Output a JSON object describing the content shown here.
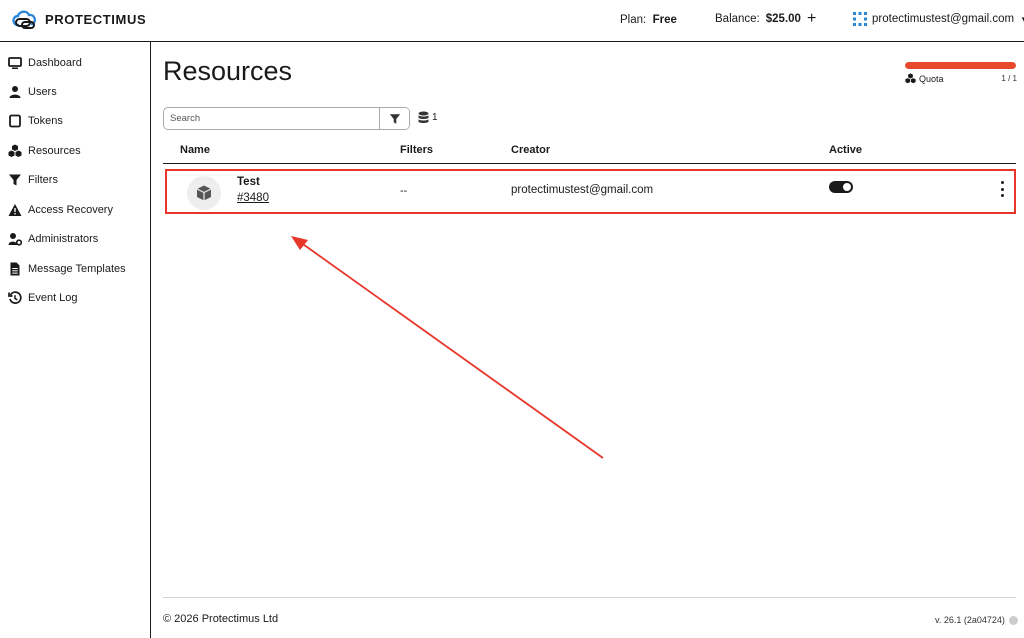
{
  "header": {
    "logo_text": "PROTECTIMUS",
    "plan_label": "Plan:",
    "plan_value": "Free",
    "balance_label": "Balance:",
    "balance_value": "$25.00",
    "account_email": "protectimustest@gmail.com"
  },
  "sidebar": {
    "items": [
      {
        "label": "Dashboard",
        "icon": "monitor-icon"
      },
      {
        "label": "Users",
        "icon": "user-icon"
      },
      {
        "label": "Tokens",
        "icon": "token-icon"
      },
      {
        "label": "Resources",
        "icon": "cubes-icon"
      },
      {
        "label": "Filters",
        "icon": "filter-icon"
      },
      {
        "label": "Access Recovery",
        "icon": "warning-icon"
      },
      {
        "label": "Administrators",
        "icon": "user-gear-icon"
      },
      {
        "label": "Message Templates",
        "icon": "document-icon"
      },
      {
        "label": "Event Log",
        "icon": "history-icon"
      }
    ]
  },
  "main": {
    "title": "Resources",
    "quota": {
      "label": "Quota",
      "count": "1 / 1",
      "fill_fraction": 1.0,
      "color": "#e8492d"
    },
    "search": {
      "placeholder": "Search"
    },
    "db_count": "1",
    "table": {
      "columns": [
        "Name",
        "Filters",
        "Creator",
        "Active"
      ],
      "rows": [
        {
          "name": "Test",
          "id": "#3480",
          "filters": "--",
          "creator": "protectimustest@gmail.com",
          "active": true
        }
      ]
    }
  },
  "footer": {
    "copyright": "© 2026 Protectimus Ltd",
    "version": "v. 26.1 (2a04724)"
  },
  "colors": {
    "accent": "#e8492d",
    "highlight_border": "#e8362a",
    "text": "#1a1a1a"
  }
}
